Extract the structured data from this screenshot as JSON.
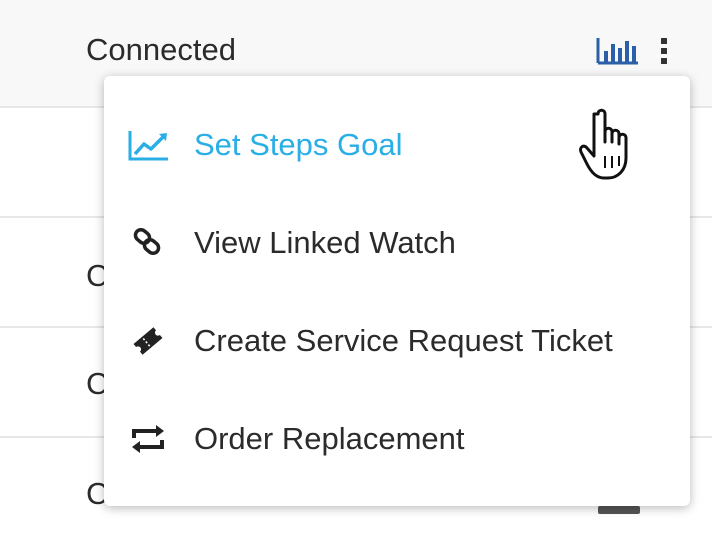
{
  "table": {
    "header_status": "Connected",
    "row_status_partial": [
      "C",
      "C",
      "C"
    ]
  },
  "actions": {
    "chart_icon": "bar-chart-icon",
    "more_icon": "kebab-menu-icon"
  },
  "menu": {
    "items": [
      {
        "label": "Set Steps Goal",
        "icon": "trending-up-icon",
        "highlighted": true,
        "color": "#29aee6"
      },
      {
        "label": "View Linked Watch",
        "icon": "link-icon",
        "highlighted": false
      },
      {
        "label": "Create Service Request Ticket",
        "icon": "ticket-icon",
        "highlighted": false
      },
      {
        "label": "Order Replacement",
        "icon": "replace-icon",
        "highlighted": false
      }
    ]
  },
  "colors": {
    "accent": "#29aee6",
    "text": "#2b2b2b",
    "divider": "#e7e7e7"
  },
  "cursor": "hand-pointer-icon"
}
